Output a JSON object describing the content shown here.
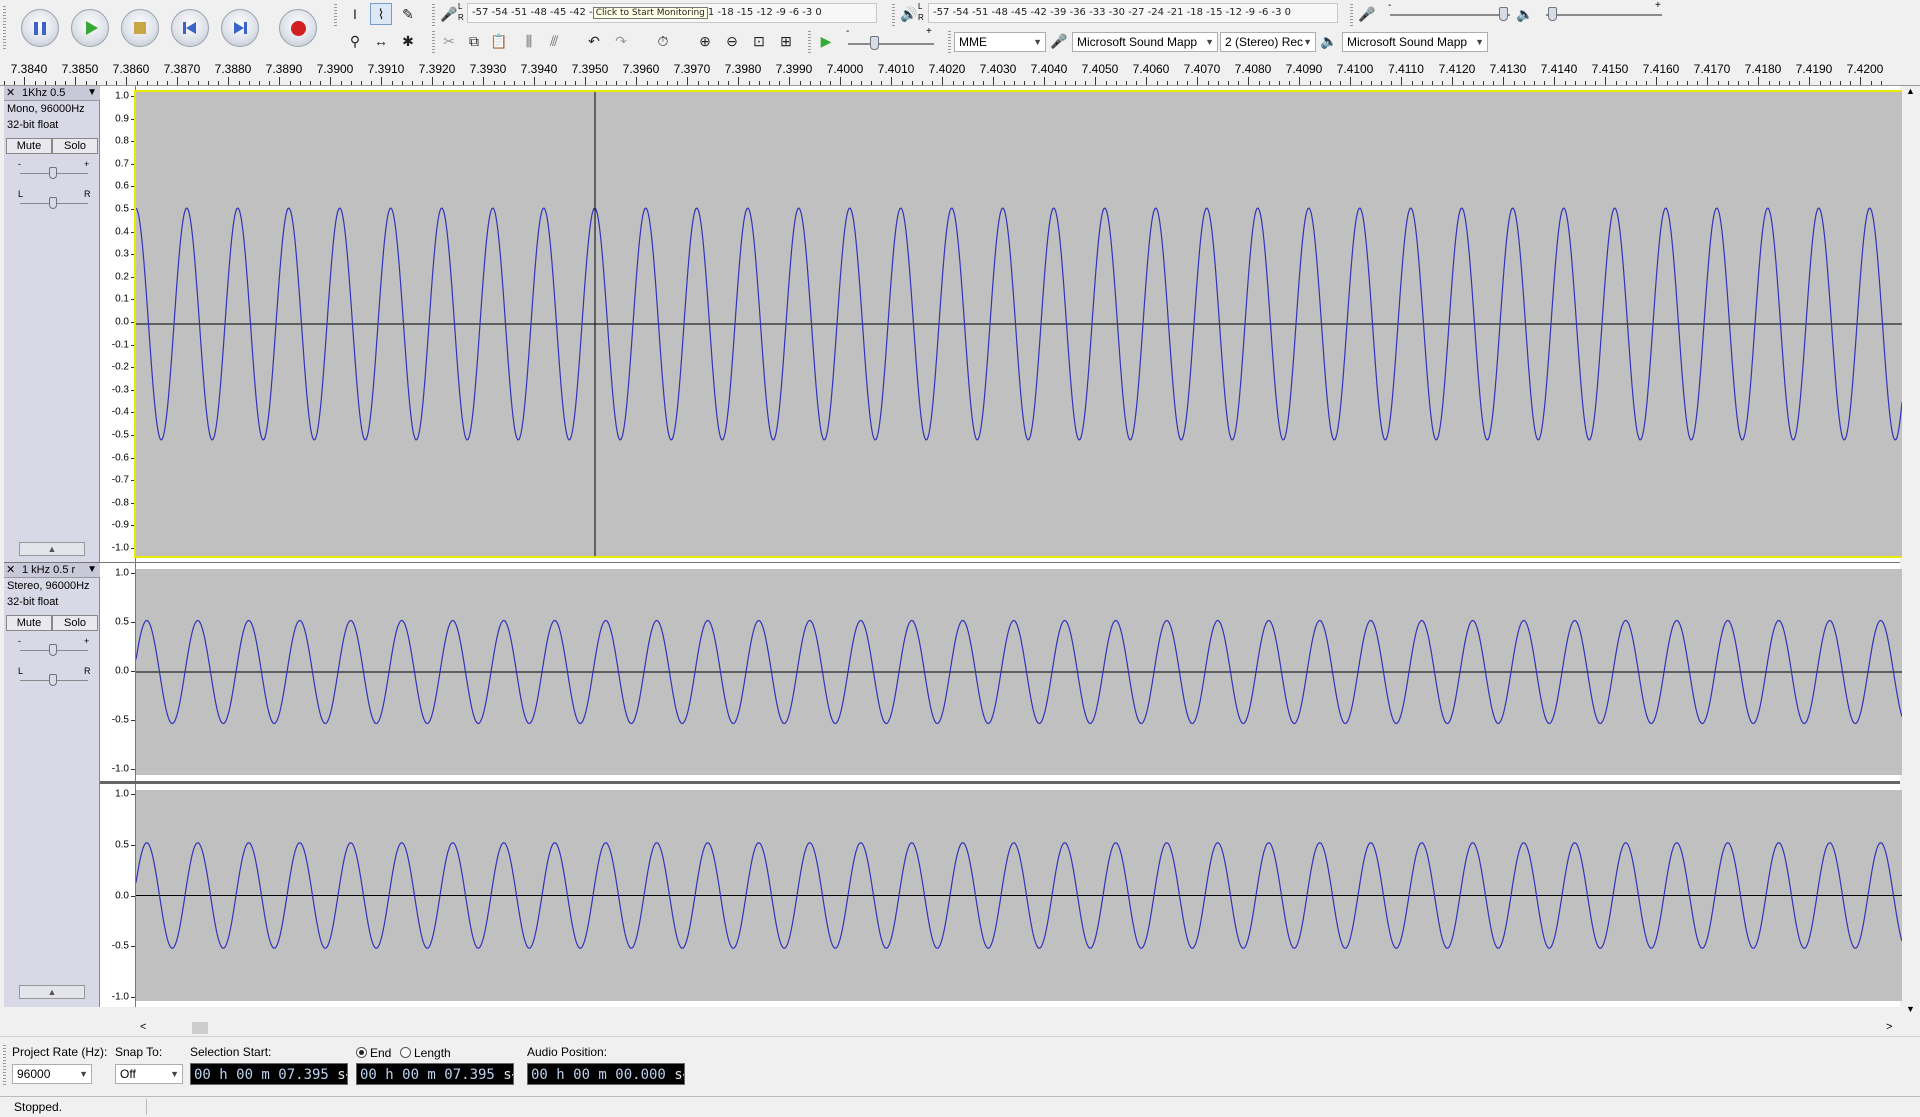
{
  "toolbar": {
    "record_meter_scale": "-57 -54 -51 -48 -45 -42 -",
    "record_meter_tooltip": "Click to Start Monitoring",
    "record_meter_scale_tail": "1 -18 -15 -12 -9 -6 -3 0",
    "playback_meter_scale": "-57 -54 -51 -48 -45 -42 -39 -36 -33 -30 -27 -24 -21 -18 -15 -12 -9 -6 -3 0",
    "host": "MME",
    "recording_device": "Microsoft Sound Mapp",
    "channels": "2 (Stereo) Rec",
    "playback_device": "Microsoft Sound Mapp",
    "meter_L": "L",
    "meter_R": "R",
    "minus": "-",
    "plus": "+"
  },
  "ruler": {
    "labels": [
      "7.3840",
      "7.3850",
      "7.3860",
      "7.3870",
      "7.3880",
      "7.3890",
      "7.3900",
      "7.3910",
      "7.3920",
      "7.3930",
      "7.3940",
      "7.3950",
      "7.3960",
      "7.3970",
      "7.3980",
      "7.3990",
      "7.4000",
      "7.4010",
      "7.4020",
      "7.4030",
      "7.4040",
      "7.4050",
      "7.4060",
      "7.4070",
      "7.4080",
      "7.4090",
      "7.4100",
      "7.4110",
      "7.4120",
      "7.4130",
      "7.4140",
      "7.4150",
      "7.4160",
      "7.4170",
      "7.4180",
      "7.4190",
      "7.4200"
    ]
  },
  "tracks": [
    {
      "name": "1Khz 0.5",
      "format": "Mono, 96000Hz",
      "bits": "32-bit float",
      "mute": "Mute",
      "solo": "Solo",
      "scale": [
        "1.0",
        "0.9",
        "0.8",
        "0.7",
        "0.6",
        "0.5",
        "0.4",
        "0.3",
        "0.2",
        "0.1",
        "0.0",
        "-0.1",
        "-0.2",
        "-0.3",
        "-0.4",
        "-0.5",
        "-0.6",
        "-0.7",
        "-0.8",
        "-0.9",
        "-1.0"
      ]
    },
    {
      "name": "1 kHz 0.5 r",
      "format": "Stereo, 96000Hz",
      "bits": "32-bit float",
      "mute": "Mute",
      "solo": "Solo",
      "scale": [
        "1.0",
        "0.5",
        "0.0",
        "-0.5",
        "-1.0"
      ]
    }
  ],
  "selection": {
    "project_rate_label": "Project Rate (Hz):",
    "project_rate": "96000",
    "snap_label": "Snap To:",
    "snap": "Off",
    "start_label": "Selection Start:",
    "end_label": "End",
    "length_label": "Length",
    "end_selected": true,
    "start_value": "00 h 00 m 07.395",
    "end_value": "00 h 00 m 07.395",
    "unit": "s",
    "audio_pos_label": "Audio Position:",
    "audio_pos_value": "00 h 00 m 00.000"
  },
  "status": "Stopped.",
  "colors": {
    "wave": "#3333bb",
    "wave_bg": "#c0c0c0",
    "focus": "#e8e800",
    "timebox_text": "#bcd2ee"
  }
}
